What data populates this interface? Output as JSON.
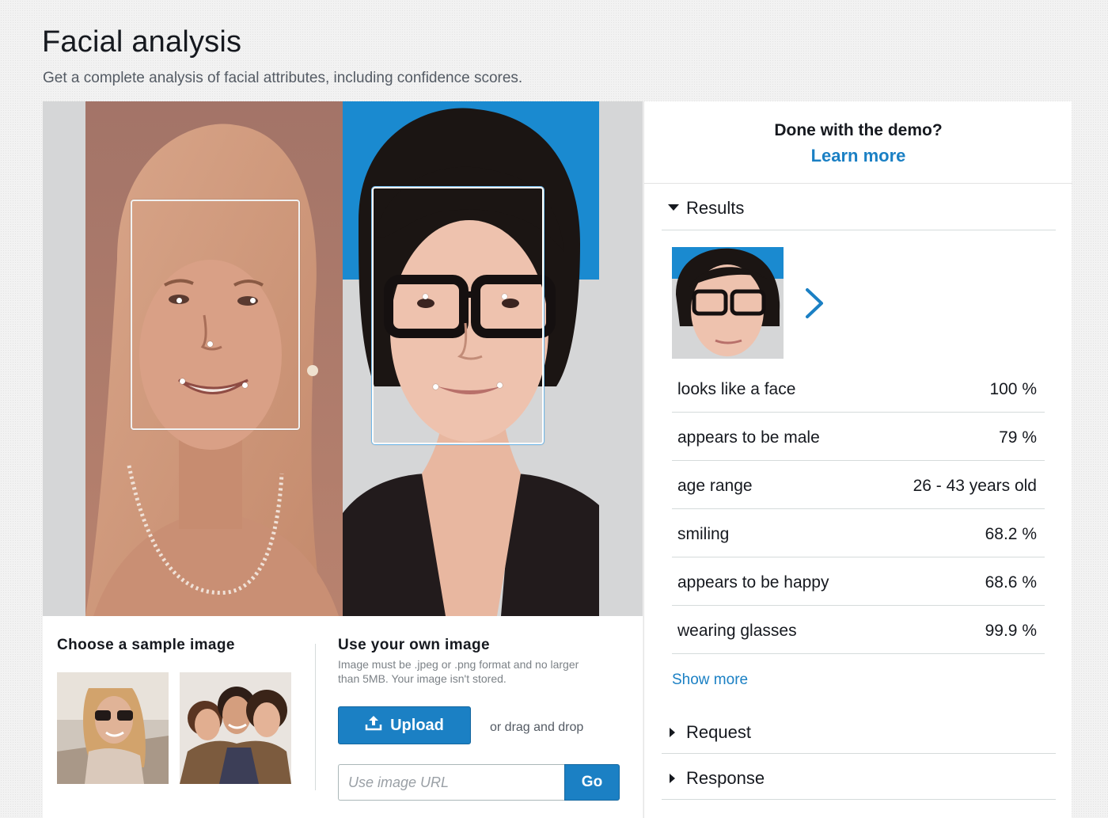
{
  "page": {
    "title": "Facial analysis",
    "subtitle": "Get a complete analysis of facial attributes, including confidence scores."
  },
  "controls": {
    "sample_title": "Choose a sample image",
    "own_title": "Use your own image",
    "own_note": "Image must be .jpeg or .png format and no larger than 5MB. Your image isn't stored.",
    "upload_label": "Upload",
    "drag_text": "or drag and drop",
    "url_placeholder": "Use image URL",
    "go_label": "Go"
  },
  "panel": {
    "demo_question": "Done with the demo?",
    "learn_more": "Learn more",
    "results_label": "Results",
    "results": [
      {
        "key": "looks like a face",
        "value": "100 %"
      },
      {
        "key": "appears to be male",
        "value": "79 %"
      },
      {
        "key": "age range",
        "value": "26 - 43 years old"
      },
      {
        "key": "smiling",
        "value": "68.2 %"
      },
      {
        "key": "appears to be happy",
        "value": "68.6 %"
      },
      {
        "key": "wearing glasses",
        "value": "99.9 %"
      }
    ],
    "show_more": "Show more",
    "request_label": "Request",
    "response_label": "Response"
  },
  "colors": {
    "accent": "#1b80c4",
    "text": "#16191f"
  },
  "icons": [
    "upload-icon",
    "chevron-right-icon",
    "caret-down-icon",
    "caret-right-icon"
  ]
}
